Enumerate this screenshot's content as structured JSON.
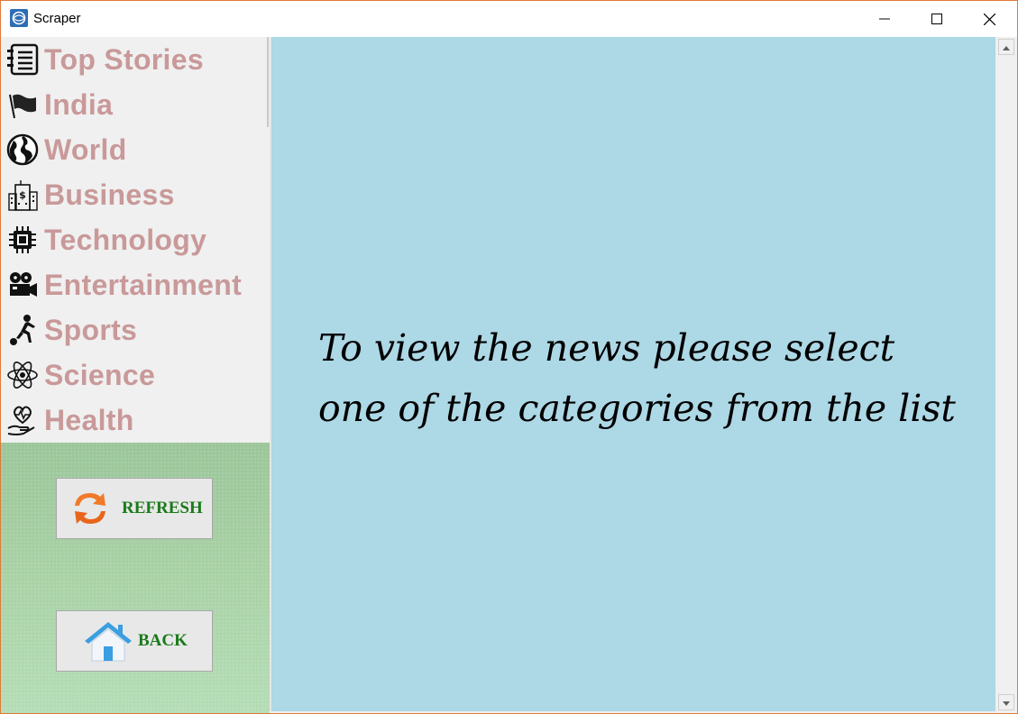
{
  "window": {
    "title": "Scraper",
    "controls": [
      "minimize-icon",
      "maximize-icon",
      "close-icon"
    ]
  },
  "sidebar": {
    "items": [
      {
        "label": "Top Stories",
        "icon": "notebook-icon"
      },
      {
        "label": "India",
        "icon": "flag-icon"
      },
      {
        "label": "World",
        "icon": "globe-icon"
      },
      {
        "label": "Business",
        "icon": "building-dollar-icon"
      },
      {
        "label": "Technology",
        "icon": "chip-icon"
      },
      {
        "label": "Entertainment",
        "icon": "film-camera-icon"
      },
      {
        "label": "Sports",
        "icon": "soccer-player-icon"
      },
      {
        "label": "Science",
        "icon": "atom-icon"
      },
      {
        "label": "Health",
        "icon": "heart-hand-icon"
      }
    ]
  },
  "actions": {
    "refresh_label": "REFRESH",
    "back_label": "BACK"
  },
  "main": {
    "message_line1": "To view the news please select",
    "message_line2": "one of the categories from the list"
  },
  "colors": {
    "category_text": "#c9999a",
    "main_background": "#add8e6",
    "action_text": "#1a7a1a",
    "window_border": "#e07a3a"
  }
}
